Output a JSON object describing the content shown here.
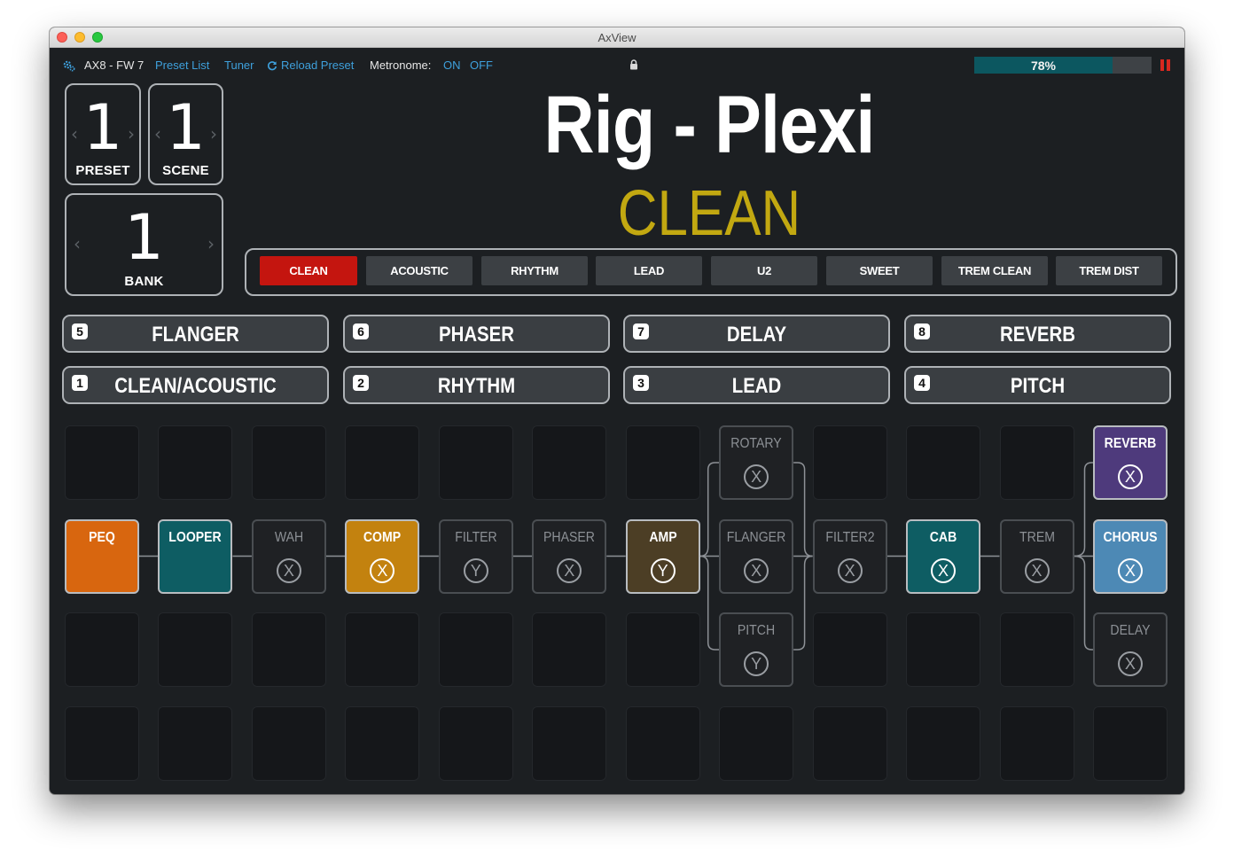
{
  "window": {
    "title": "AxView"
  },
  "statusbar": {
    "device": "AX8 - FW 7",
    "preset_list": "Preset List",
    "tuner": "Tuner",
    "reload_preset": "Reload Preset",
    "metronome_label": "Metronome:",
    "metronome_on": "ON",
    "metronome_off": "OFF",
    "cpu_label": "78%",
    "cpu_percent": 78
  },
  "counters": {
    "preset": {
      "value": "1",
      "label": "PRESET"
    },
    "scene": {
      "value": "1",
      "label": "SCENE"
    },
    "bank": {
      "value": "1",
      "label": "BANK"
    }
  },
  "preset_name": "Rig - Plexi",
  "scene_name": "CLEAN",
  "scenes": [
    "CLEAN",
    "ACOUSTIC",
    "RHYTHM",
    "LEAD",
    "U2",
    "SWEET",
    "TREM CLEAN",
    "TREM DIST"
  ],
  "active_scene": 0,
  "effects_top": [
    {
      "num": "5",
      "label": "FLANGER"
    },
    {
      "num": "6",
      "label": "PHASER"
    },
    {
      "num": "7",
      "label": "DELAY"
    },
    {
      "num": "8",
      "label": "REVERB"
    }
  ],
  "effects_bottom": [
    {
      "num": "1",
      "label": "CLEAN/ACOUSTIC"
    },
    {
      "num": "2",
      "label": "RHYTHM"
    },
    {
      "num": "3",
      "label": "LEAD"
    },
    {
      "num": "4",
      "label": "PITCH"
    }
  ],
  "blocks": [
    {
      "name": "PEQ",
      "channel": "",
      "col": 0,
      "row": 1,
      "on": true,
      "color": "#d8660f"
    },
    {
      "name": "LOOPER",
      "channel": "",
      "col": 1,
      "row": 1,
      "on": true,
      "color": "#0e5d63"
    },
    {
      "name": "WAH",
      "channel": "X",
      "col": 2,
      "row": 1,
      "on": false,
      "color": ""
    },
    {
      "name": "COMP",
      "channel": "X",
      "col": 3,
      "row": 1,
      "on": true,
      "color": "#c3820f"
    },
    {
      "name": "FILTER",
      "channel": "Y",
      "col": 4,
      "row": 1,
      "on": false,
      "color": ""
    },
    {
      "name": "PHASER",
      "channel": "X",
      "col": 5,
      "row": 1,
      "on": false,
      "color": ""
    },
    {
      "name": "AMP",
      "channel": "Y",
      "col": 6,
      "row": 1,
      "on": true,
      "color": "#4c3e25"
    },
    {
      "name": "ROTARY",
      "channel": "X",
      "col": 7,
      "row": 0,
      "on": false,
      "color": ""
    },
    {
      "name": "FLANGER",
      "channel": "X",
      "col": 7,
      "row": 1,
      "on": false,
      "color": ""
    },
    {
      "name": "PITCH",
      "channel": "Y",
      "col": 7,
      "row": 2,
      "on": false,
      "color": ""
    },
    {
      "name": "FILTER2",
      "channel": "X",
      "col": 8,
      "row": 1,
      "on": false,
      "color": ""
    },
    {
      "name": "CAB",
      "channel": "X",
      "col": 9,
      "row": 1,
      "on": true,
      "color": "#0e5d63"
    },
    {
      "name": "TREM",
      "channel": "X",
      "col": 10,
      "row": 1,
      "on": false,
      "color": ""
    },
    {
      "name": "REVERB",
      "channel": "X",
      "col": 11,
      "row": 0,
      "on": true,
      "color": "#4e3a7c"
    },
    {
      "name": "CHORUS",
      "channel": "X",
      "col": 11,
      "row": 1,
      "on": true,
      "color": "#4d89b5"
    },
    {
      "name": "DELAY",
      "channel": "X",
      "col": 11,
      "row": 2,
      "on": false,
      "color": ""
    }
  ]
}
